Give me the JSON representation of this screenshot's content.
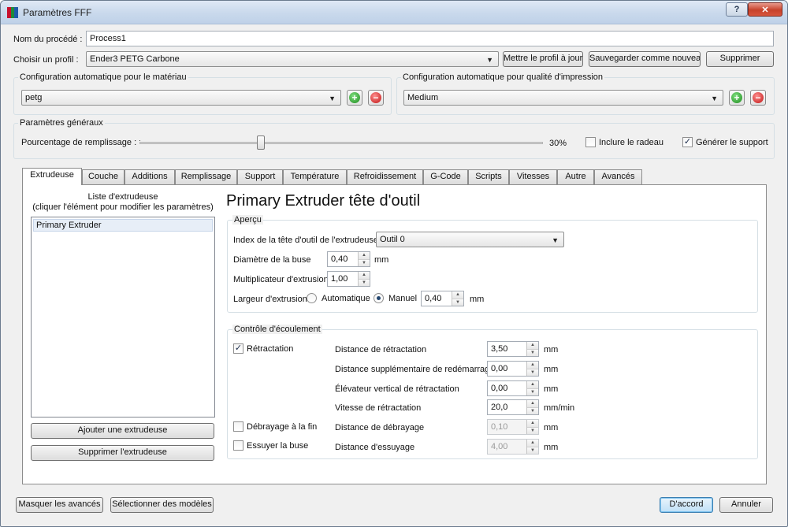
{
  "window": {
    "title": "Paramètres FFF",
    "help_label": "?",
    "close_label": "✕"
  },
  "process": {
    "name_label": "Nom du procédé :",
    "name_value": "Process1",
    "profile_label": "Choisir un profil :",
    "profile_value": "Ender3 PETG Carbone",
    "update_profile": "Mettre le profil à jour",
    "save_as_new": "Sauvegarder comme nouveau",
    "delete": "Supprimer"
  },
  "auto_material": {
    "title": "Configuration automatique pour le matériau",
    "value": "petg"
  },
  "auto_quality": {
    "title": "Configuration automatique pour qualité d'impression",
    "value": "Medium"
  },
  "general": {
    "title": "Paramètres généraux",
    "infill_label": "Pourcentage de remplissage :",
    "infill_value": "30%",
    "infill_fraction": 0.3,
    "raft_label": "Inclure le radeau",
    "raft_checked": false,
    "support_label": "Générer le support",
    "support_checked": true
  },
  "tabs": [
    {
      "label": "Extrudeuse",
      "active": true
    },
    {
      "label": "Couche"
    },
    {
      "label": "Additions"
    },
    {
      "label": "Remplissage"
    },
    {
      "label": "Support"
    },
    {
      "label": "Température"
    },
    {
      "label": "Refroidissement"
    },
    {
      "label": "G-Code"
    },
    {
      "label": "Scripts"
    },
    {
      "label": "Vitesses"
    },
    {
      "label": "Autre"
    },
    {
      "label": "Avancés"
    }
  ],
  "extruder_list": {
    "header_line1": "Liste d'extrudeuse",
    "header_line2": "(cliquer l'élément pour modifier les paramètres)",
    "items": [
      "Primary Extruder"
    ],
    "add_button": "Ajouter une extrudeuse",
    "remove_button": "Supprimer l'extrudeuse"
  },
  "extruder": {
    "heading": "Primary Extruder tête d'outil",
    "overview": {
      "title": "Aperçu",
      "tool_index_label": "Index de la tête d'outil de l'extrudeuse",
      "tool_index_value": "Outil 0",
      "nozzle_label": "Diamètre de la buse",
      "nozzle_value": "0,40",
      "nozzle_unit": "mm",
      "multiplier_label": "Multiplicateur d'extrusion",
      "multiplier_value": "1,00",
      "width_label": "Largeur d'extrusion",
      "width_auto_label": "Automatique",
      "width_manual_label": "Manuel",
      "width_value": "0,40",
      "width_unit": "mm"
    },
    "flow": {
      "title": "Contrôle d'écoulement",
      "retraction_label": "Rétractation",
      "retraction_checked": true,
      "coast_label": "Débrayage à la fin",
      "coast_checked": false,
      "wipe_label": "Essuyer la buse",
      "wipe_checked": false,
      "retract_distance_label": "Distance de rétractation",
      "retract_distance_value": "3,50",
      "retract_distance_unit": "mm",
      "extra_restart_label": "Distance supplémentaire de redémarrage",
      "extra_restart_value": "0,00",
      "extra_restart_unit": "mm",
      "vertical_lift_label": "Élévateur vertical de rétractation",
      "vertical_lift_value": "0,00",
      "vertical_lift_unit": "mm",
      "retract_speed_label": "Vitesse de rétractation",
      "retract_speed_value": "20,0",
      "retract_speed_unit": "mm/min",
      "coast_distance_label": "Distance de débrayage",
      "coast_distance_value": "0,10",
      "coast_distance_unit": "mm",
      "wipe_distance_label": "Distance d'essuyage",
      "wipe_distance_value": "4,00",
      "wipe_distance_unit": "mm"
    }
  },
  "footer": {
    "hide_advanced": "Masquer les avancés",
    "select_models": "Sélectionner des modèles",
    "ok": "D'accord",
    "cancel": "Annuler"
  },
  "colors": {
    "window_bg": "#f0f0f0",
    "titlebar": "#c9d9ec",
    "close_button": "#c7422b",
    "add_icon": "#1e8a1e",
    "remove_icon": "#c01414"
  }
}
